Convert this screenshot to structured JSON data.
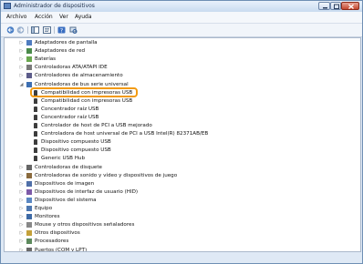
{
  "window": {
    "title": "Administrador de dispositivos"
  },
  "menu": [
    "Archivo",
    "Acción",
    "Ver",
    "Ayuda"
  ],
  "toolbar": {
    "buttons": [
      "back-arrow-icon",
      "forward-arrow-icon",
      "show-hide-console-tree-icon",
      "properties-icon",
      "help-icon",
      "scan-hardware-icon"
    ]
  },
  "colors": {
    "highlight": "#f29a11",
    "title_bar": "#c9dbf0"
  },
  "tree": {
    "rows": [
      {
        "label": "Adaptadores de pantalla",
        "state": "collapsed",
        "level": 1,
        "icon": "display-adapter-icon"
      },
      {
        "label": "Adaptadores de red",
        "state": "collapsed",
        "level": 1,
        "icon": "network-adapter-icon"
      },
      {
        "label": "Baterías",
        "state": "collapsed",
        "level": 1,
        "icon": "battery-icon"
      },
      {
        "label": "Controladoras ATA/ATAPI IDE",
        "state": "collapsed",
        "level": 1,
        "icon": "ide-controller-icon"
      },
      {
        "label": "Controladores de almacenamiento",
        "state": "collapsed",
        "level": 1,
        "icon": "storage-controller-icon"
      },
      {
        "label": "Controladoras de bus serie universal",
        "state": "expanded",
        "level": 1,
        "icon": "usb-controller-icon"
      },
      {
        "label": "Compatibilidad con impresoras USB",
        "state": "leaf",
        "level": 2,
        "icon": "usb-plug-icon"
      },
      {
        "label": "Compatibilidad con impresoras USB",
        "state": "leaf",
        "level": 2,
        "icon": "usb-plug-icon"
      },
      {
        "label": "Concentrador raíz USB",
        "state": "leaf",
        "level": 2,
        "icon": "usb-plug-icon"
      },
      {
        "label": "Concentrador raíz USB",
        "state": "leaf",
        "level": 2,
        "icon": "usb-plug-icon"
      },
      {
        "label": "Controlador de host de PCI a USB mejorado",
        "state": "leaf",
        "level": 2,
        "icon": "usb-plug-icon"
      },
      {
        "label": "Controladora de host universal de PCI a USB Intel(R) 82371AB/EB",
        "state": "leaf",
        "level": 2,
        "icon": "usb-plug-icon"
      },
      {
        "label": "Dispositivo compuesto USB",
        "state": "leaf",
        "level": 2,
        "icon": "usb-plug-icon"
      },
      {
        "label": "Dispositivo compuesto USB",
        "state": "leaf",
        "level": 2,
        "icon": "usb-plug-icon"
      },
      {
        "label": "Generic USB Hub",
        "state": "leaf",
        "level": 2,
        "icon": "usb-plug-icon"
      },
      {
        "label": "Controladoras de disquete",
        "state": "collapsed",
        "level": 1,
        "icon": "floppy-controller-icon"
      },
      {
        "label": "Controladoras de sonido y vídeo y dispositivos de juego",
        "state": "collapsed",
        "level": 1,
        "icon": "sound-icon"
      },
      {
        "label": "Dispositivos de imagen",
        "state": "collapsed",
        "level": 1,
        "icon": "imaging-device-icon"
      },
      {
        "label": "Dispositivos de interfaz de usuario (HID)",
        "state": "collapsed",
        "level": 1,
        "icon": "hid-icon"
      },
      {
        "label": "Dispositivos del sistema",
        "state": "collapsed",
        "level": 1,
        "icon": "system-devices-icon"
      },
      {
        "label": "Equipo",
        "state": "collapsed",
        "level": 1,
        "icon": "computer-icon"
      },
      {
        "label": "Monitores",
        "state": "collapsed",
        "level": 1,
        "icon": "monitor-icon"
      },
      {
        "label": "Mouse y otros dispositivos señaladores",
        "state": "collapsed",
        "level": 1,
        "icon": "mouse-icon"
      },
      {
        "label": "Otros dispositivos",
        "state": "collapsed",
        "level": 1,
        "icon": "other-devices-icon"
      },
      {
        "label": "Procesadores",
        "state": "collapsed",
        "level": 1,
        "icon": "processor-icon"
      },
      {
        "label": "Puertos (COM y LPT)",
        "state": "collapsed",
        "level": 1,
        "icon": "ports-icon"
      }
    ]
  }
}
